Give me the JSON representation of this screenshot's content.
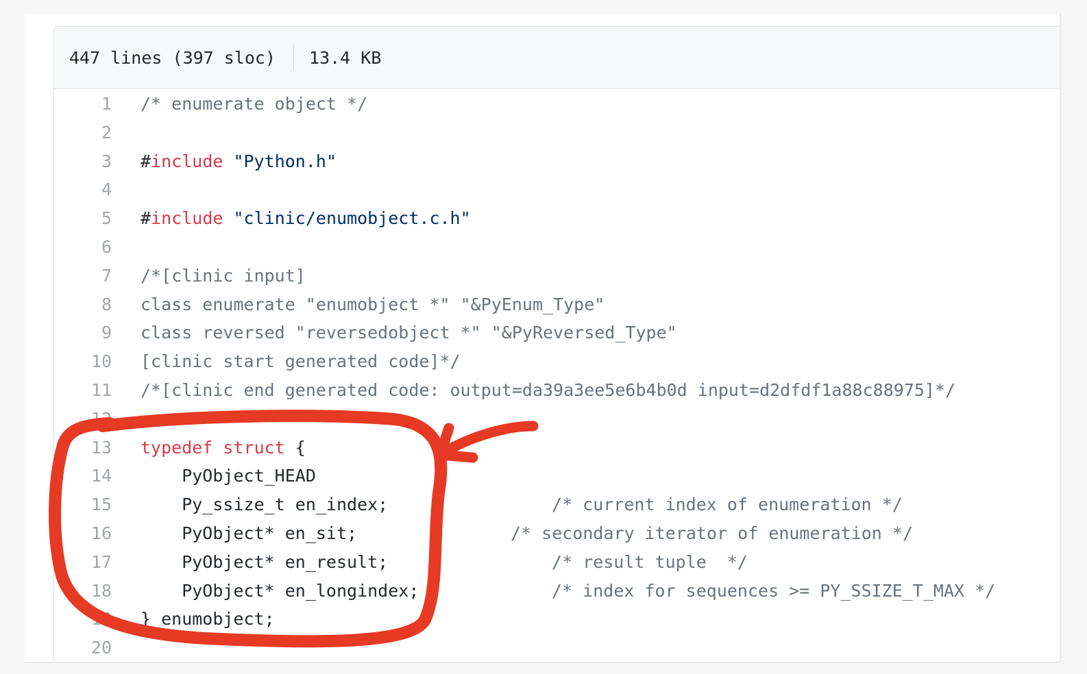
{
  "file_info": {
    "lines": "447 lines (397 sloc)",
    "size": "13.4 KB"
  },
  "annotation_color": "#e63a25",
  "code_lines": [
    {
      "n": "1",
      "parts": [
        {
          "t": "/* enumerate object */",
          "c": "comment"
        }
      ]
    },
    {
      "n": "2",
      "parts": []
    },
    {
      "n": "3",
      "parts": [
        {
          "t": "#",
          "c": "plain"
        },
        {
          "t": "include",
          "c": "kw"
        },
        {
          "t": " ",
          "c": "plain"
        },
        {
          "t": "\"Python.h\"",
          "c": "str"
        }
      ]
    },
    {
      "n": "4",
      "parts": []
    },
    {
      "n": "5",
      "parts": [
        {
          "t": "#",
          "c": "plain"
        },
        {
          "t": "include",
          "c": "kw"
        },
        {
          "t": " ",
          "c": "plain"
        },
        {
          "t": "\"clinic/enumobject.c.h\"",
          "c": "str"
        }
      ]
    },
    {
      "n": "6",
      "parts": []
    },
    {
      "n": "7",
      "parts": [
        {
          "t": "/*[clinic input]",
          "c": "comment"
        }
      ]
    },
    {
      "n": "8",
      "parts": [
        {
          "t": "class enumerate \"enumobject *\" \"&PyEnum_Type\"",
          "c": "comment"
        }
      ]
    },
    {
      "n": "9",
      "parts": [
        {
          "t": "class reversed \"reversedobject *\" \"&PyReversed_Type\"",
          "c": "comment"
        }
      ]
    },
    {
      "n": "10",
      "parts": [
        {
          "t": "[clinic start generated code]*/",
          "c": "comment"
        }
      ]
    },
    {
      "n": "11",
      "parts": [
        {
          "t": "/*[clinic end generated code: output=da39a3ee5e6b4b0d input=d2dfdf1a88c88975]*/",
          "c": "comment"
        }
      ]
    },
    {
      "n": "12",
      "parts": []
    },
    {
      "n": "13",
      "parts": [
        {
          "t": "typedef",
          "c": "kw"
        },
        {
          "t": " ",
          "c": "plain"
        },
        {
          "t": "struct",
          "c": "kw"
        },
        {
          "t": " {",
          "c": "plain"
        }
      ]
    },
    {
      "n": "14",
      "parts": [
        {
          "t": "    PyObject_HEAD",
          "c": "plain"
        }
      ]
    },
    {
      "n": "15",
      "parts": [
        {
          "t": "    Py_ssize_t en_index;",
          "c": "plain"
        }
      ],
      "trail": "/* current index of enumeration */",
      "trail_col": 1
    },
    {
      "n": "16",
      "parts": [
        {
          "t": "    PyObject* en_sit;",
          "c": "plain"
        }
      ],
      "trail": "/* secondary iterator of enumeration */",
      "trail_col": 0
    },
    {
      "n": "17",
      "parts": [
        {
          "t": "    PyObject* en_result;",
          "c": "plain"
        }
      ],
      "trail": "/* result tuple  */",
      "trail_col": 1
    },
    {
      "n": "18",
      "parts": [
        {
          "t": "    PyObject* en_longindex;",
          "c": "plain"
        }
      ],
      "trail": "/* index for sequences >= PY_SSIZE_T_MAX */",
      "trail_col": 1
    },
    {
      "n": "19",
      "parts": [
        {
          "t": "} enumobject;",
          "c": "plain"
        }
      ]
    },
    {
      "n": "20",
      "parts": []
    }
  ]
}
